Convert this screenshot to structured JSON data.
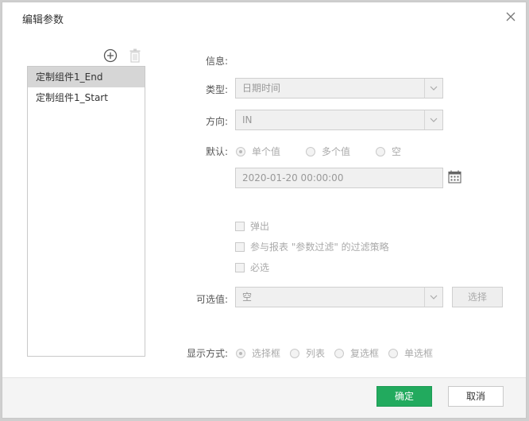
{
  "dialog": {
    "title": "编辑参数",
    "close_icon": "close-icon"
  },
  "toolbar": {
    "add_icon": "plus-circle-icon",
    "delete_icon": "trash-icon"
  },
  "param_list": {
    "items": [
      {
        "label": "定制组件1_End",
        "selected": true
      },
      {
        "label": "定制组件1_Start",
        "selected": false
      }
    ]
  },
  "form": {
    "info_label": "信息:",
    "type_label": "类型:",
    "type_value": "日期时间",
    "direction_label": "方向:",
    "direction_value": "IN",
    "default_label": "默认:",
    "default_options": [
      {
        "label": "单个值",
        "checked": true
      },
      {
        "label": "多个值",
        "checked": false
      },
      {
        "label": "空",
        "checked": false
      }
    ],
    "default_value": "2020-01-20 00:00:00",
    "checkboxes": [
      {
        "label": "弹出"
      },
      {
        "label": "参与报表 \"参数过滤\" 的过滤策略"
      },
      {
        "label": "必选"
      }
    ],
    "optional_label": "可选值:",
    "optional_value": "空",
    "choose_button": "选择",
    "display_label": "显示方式:",
    "display_options": [
      {
        "label": "选择框",
        "checked": true
      },
      {
        "label": "列表",
        "checked": false
      },
      {
        "label": "复选框",
        "checked": false
      },
      {
        "label": "单选框",
        "checked": false
      }
    ]
  },
  "footer": {
    "ok_label": "确定",
    "cancel_label": "取消"
  },
  "colors": {
    "primary": "#22aa5e",
    "selected_row": "#d6d6d6",
    "disabled_bg": "#f0f0f0"
  }
}
